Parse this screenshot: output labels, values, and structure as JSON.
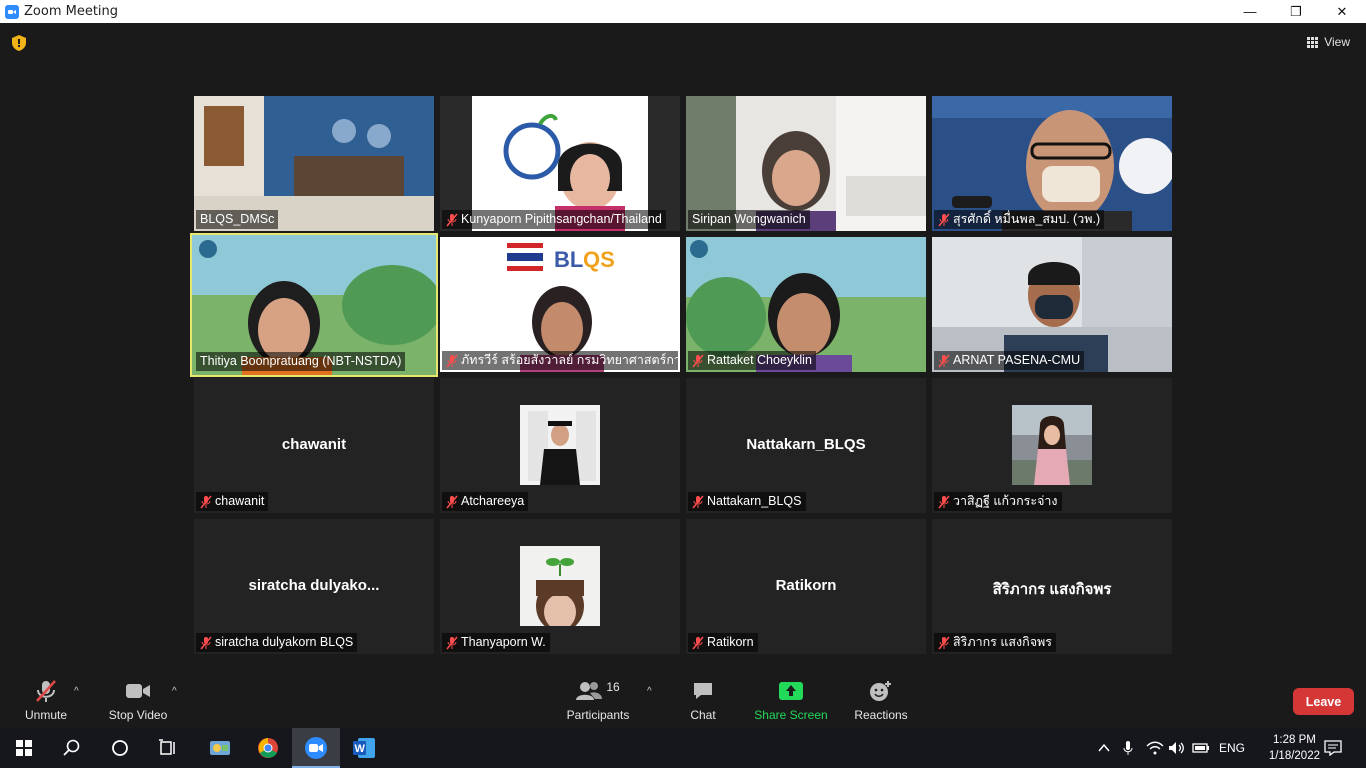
{
  "window": {
    "title": "Zoom Meeting",
    "minimize": "—",
    "restore": "❐",
    "close": "✕"
  },
  "top_bar": {
    "view_label": "View"
  },
  "tiles": [
    {
      "name": "BLQS_DMSc",
      "muted": false,
      "type": "video"
    },
    {
      "name": "Kunyaporn Pipithsangchan/Thailand",
      "muted": true,
      "type": "video"
    },
    {
      "name": "Siripan Wongwanich",
      "muted": false,
      "type": "video"
    },
    {
      "name": "สุรศักดิ์ หมื่นพล_สมป. (วพ.)",
      "muted": true,
      "type": "video"
    },
    {
      "name": "Thitiya Boonpratuang (NBT-NSTDA)",
      "muted": false,
      "type": "video",
      "active": true
    },
    {
      "name": "ภัทรวีร์ สร้อยสังวาลย์ กรมวิทยาศาสตร์การแพ...",
      "muted": true,
      "type": "video"
    },
    {
      "name": "Rattaket Choeyklin",
      "muted": true,
      "type": "video"
    },
    {
      "name": "ARNAT PASENA-CMU",
      "muted": true,
      "type": "video"
    },
    {
      "name": "chawanit",
      "muted": true,
      "type": "text",
      "center": "chawanit"
    },
    {
      "name": "Atchareeya",
      "muted": true,
      "type": "avatar"
    },
    {
      "name": "Nattakarn_BLQS",
      "muted": true,
      "type": "text",
      "center": "Nattakarn_BLQS"
    },
    {
      "name": "วาสิฏฐี แก้วกระจ่าง",
      "muted": true,
      "type": "avatar"
    },
    {
      "name": "siratcha dulyakorn BLQS",
      "muted": true,
      "type": "text",
      "center": "siratcha  dulyako..."
    },
    {
      "name": "Thanyaporn W.",
      "muted": true,
      "type": "avatar"
    },
    {
      "name": "Ratikorn",
      "muted": true,
      "type": "text",
      "center": "Ratikorn"
    },
    {
      "name": "สิริภากร แสงกิจพร",
      "muted": true,
      "type": "text",
      "center": "สิริภากร แสงกิจพร"
    }
  ],
  "toolbar": {
    "unmute": "Unmute",
    "stop_video": "Stop Video",
    "participants": "Participants",
    "participants_count": "16",
    "chat": "Chat",
    "share_screen": "Share Screen",
    "reactions": "Reactions",
    "leave": "Leave"
  },
  "taskbar": {
    "language": "ENG",
    "time": "1:28 PM",
    "date": "1/18/2022"
  },
  "colors": {
    "accent": "#2d8cff",
    "share_green": "#23d959",
    "leave_red": "#d53736",
    "active_speaker": "#e8e870"
  }
}
